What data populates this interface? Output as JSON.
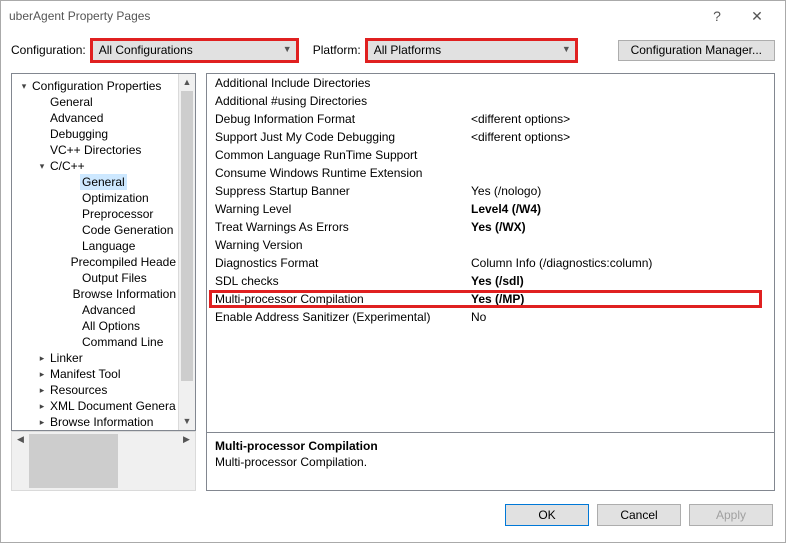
{
  "window": {
    "title": "uberAgent Property Pages"
  },
  "toolbar": {
    "config_label": "Configuration:",
    "config_value": "All Configurations",
    "platform_label": "Platform:",
    "platform_value": "All Platforms",
    "config_mgr": "Configuration Manager..."
  },
  "tree": {
    "root": "Configuration Properties",
    "items": [
      "General",
      "Advanced",
      "Debugging",
      "VC++ Directories"
    ],
    "cc": {
      "label": "C/C++",
      "children": [
        "General",
        "Optimization",
        "Preprocessor",
        "Code Generation",
        "Language",
        "Precompiled Heade",
        "Output Files",
        "Browse Information",
        "Advanced",
        "All Options",
        "Command Line"
      ]
    },
    "after": [
      "Linker",
      "Manifest Tool",
      "Resources",
      "XML Document Genera",
      "Browse Information"
    ]
  },
  "grid": [
    {
      "k": "Additional Include Directories",
      "v": ""
    },
    {
      "k": "Additional #using Directories",
      "v": ""
    },
    {
      "k": "Debug Information Format",
      "v": "<different options>"
    },
    {
      "k": "Support Just My Code Debugging",
      "v": "<different options>"
    },
    {
      "k": "Common Language RunTime Support",
      "v": ""
    },
    {
      "k": "Consume Windows Runtime Extension",
      "v": ""
    },
    {
      "k": "Suppress Startup Banner",
      "v": "Yes (/nologo)"
    },
    {
      "k": "Warning Level",
      "v": "Level4 (/W4)",
      "bold": true
    },
    {
      "k": "Treat Warnings As Errors",
      "v": "Yes (/WX)",
      "bold": true
    },
    {
      "k": "Warning Version",
      "v": ""
    },
    {
      "k": "Diagnostics Format",
      "v": "Column Info (/diagnostics:column)"
    },
    {
      "k": "SDL checks",
      "v": "Yes (/sdl)",
      "bold": true
    },
    {
      "k": "Multi-processor Compilation",
      "v": "Yes (/MP)",
      "bold": true,
      "highlight": true
    },
    {
      "k": "Enable Address Sanitizer (Experimental)",
      "v": "No"
    }
  ],
  "desc": {
    "title": "Multi-processor Compilation",
    "body": "Multi-processor Compilation."
  },
  "buttons": {
    "ok": "OK",
    "cancel": "Cancel",
    "apply": "Apply"
  }
}
